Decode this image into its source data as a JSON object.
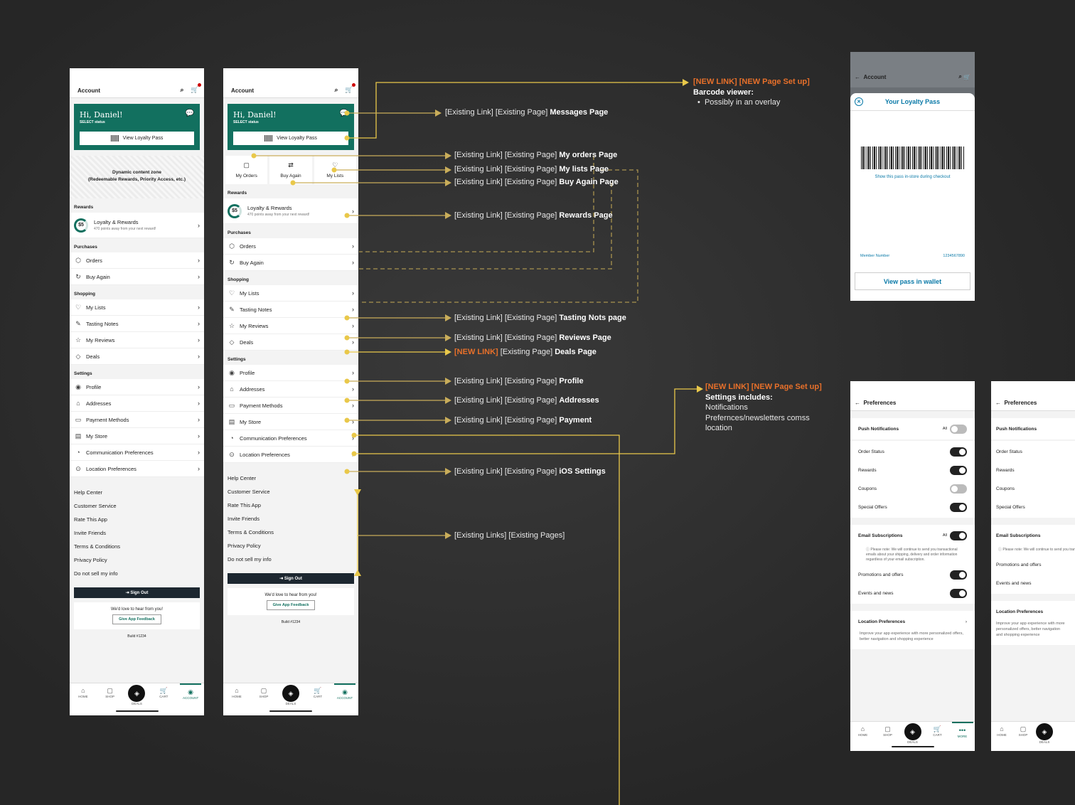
{
  "phone": {
    "topbar_title": "Account",
    "greeting": "Hi, Daniel!",
    "status": "SELECT status",
    "loyalty_pass_button": "View Loyalty Pass",
    "dynamic_zone": [
      "Dynamic content zone",
      "(Redeemable Rewards, Priority Access, etc.)"
    ],
    "quick": [
      "My Orders",
      "Buy Again",
      "My Lists"
    ],
    "sections": {
      "rewards": "Rewards",
      "purchases": "Purchases",
      "shopping": "Shopping",
      "settings": "Settings"
    },
    "loyalty": {
      "amount": "$5",
      "title": "Loyalty & Rewards",
      "sub": "470 points away from your next reward!"
    },
    "purchases": [
      "Orders",
      "Buy Again"
    ],
    "shopping": [
      "My Lists",
      "Tasting Notes",
      "My Reviews",
      "Deals"
    ],
    "settings": [
      "Profile",
      "Addresses",
      "Payment Methods",
      "My Store",
      "Communication Preferences",
      "Location Preferences"
    ],
    "links": [
      "Help Center",
      "Customer Service",
      "Rate This App",
      "Invite Friends",
      "Terms & Conditions",
      "Privacy Policy",
      "Do not sell my info"
    ],
    "sign_out": "Sign Out",
    "feedback_prompt": "We'd love to hear from you!",
    "feedback_button": "Give App Feedback",
    "build": "Build #1234",
    "tabs": [
      "HOME",
      "SHOP",
      "DEALS",
      "CART",
      "ACCOUNT"
    ]
  },
  "annotations": {
    "messages": [
      "[Existing Link] [Existing Page] ",
      "Messages Page"
    ],
    "orders": [
      "[Existing Link] [Existing Page] ",
      "My orders Page"
    ],
    "lists": [
      "[Existing Link] [Existing Page] ",
      "My lists Page"
    ],
    "buy_again": [
      "[Existing Link] [Existing Page] ",
      "Buy Again Page"
    ],
    "rewards": [
      "[Existing Link] [Existing Page] ",
      "Rewards Page"
    ],
    "tasting": [
      "[Existing Link] [Existing Page] ",
      "Tasting Nots page"
    ],
    "reviews": [
      "[Existing Link] [Existing Page] ",
      "Reviews Page"
    ],
    "deals": [
      "[NEW LINK]",
      " [Existing Page] ",
      "Deals Page"
    ],
    "profile": [
      "[Existing Link] [Existing Page] ",
      "Profile"
    ],
    "addresses": [
      "[Existing Link] [Existing Page] ",
      "Addresses"
    ],
    "payment": [
      "[Existing Link] [Existing Page] ",
      "Payment"
    ],
    "ios": [
      "[Existing Link] [Existing Page] ",
      "iOS Settings"
    ],
    "pages": "[Existing Links] [Existing Pages]",
    "barcode": {
      "tag": "[NEW LINK] [NEW Page Set up]",
      "title": "Barcode viewer:",
      "bullet": "Possibly in an overlay"
    },
    "settings_block": {
      "tag": "[NEW LINK] [NEW Page Set up]",
      "title": "Settings includes:",
      "lines": [
        "Notifications",
        "Prefernces/newsletters comss",
        "location"
      ]
    }
  },
  "overlay": {
    "bg_title": "Account",
    "title": "Your Loyalty Pass",
    "hint": "Show this pass in-store during checkout",
    "member_label": "Member Number",
    "member_number": "1234567890",
    "wallet_button": "View pass in wallet"
  },
  "preferences": {
    "title": "Preferences",
    "push": "Push Notifications",
    "all": "All",
    "push_items": [
      "Order Status",
      "Rewards",
      "Coupons",
      "Special Offers"
    ],
    "email": "Email Subscriptions",
    "email_note": "Please note: We will continue to send you transactional emails about your shipping, delivery and order information regardless of your email subscription.",
    "email_items": [
      "Promotions and offers",
      "Events and news"
    ],
    "location_title": "Location Preferences",
    "location_sub": "Improve your app experience with more personalized offers, better navigation and shopping experience",
    "tabs": [
      "HOME",
      "SHOP",
      "DEALS",
      "CART",
      "MORE"
    ]
  },
  "colors": {
    "accent": "#12705f",
    "line": "#e9c84a",
    "new": "#e8702a"
  }
}
